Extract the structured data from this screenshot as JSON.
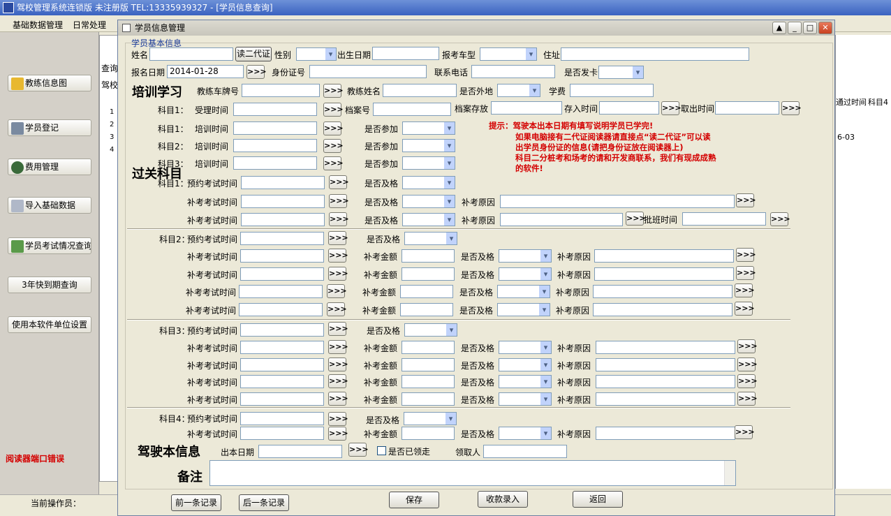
{
  "app": {
    "title": "驾校管理系统连锁版 未注册版 TEL:13335939327  - [学员信息查询]"
  },
  "menu": {
    "basic": "基础数据管理",
    "daily": "日常处理"
  },
  "sidebar": {
    "items": [
      "教练信息图",
      "学员登记",
      "费用管理",
      "导入基础数据",
      "学员考试情况查询",
      "3年快到期查询",
      "使用本软件单位设置"
    ],
    "error": "阅读器端口错误"
  },
  "status": {
    "operator_label": "当前操作员："
  },
  "bg": {
    "query1": "查询",
    "query2": "驾校",
    "rows": [
      "1",
      "2",
      "3",
      "4"
    ],
    "col1": "通过时间",
    "col2": "科目4",
    "cell": "6-03"
  },
  "window": {
    "title": "学员信息管理"
  },
  "basic": {
    "group": "学员基本信息",
    "name": "姓名",
    "read_id": "读二代证",
    "gender": "性别",
    "birth": "出生日期",
    "car_type": "报考车型",
    "address": "住址",
    "reg_date_label": "报名日期",
    "reg_date": "2014-01-28",
    "id_no": "身份证号",
    "phone": "联系电话",
    "card": "是否发卡"
  },
  "training": {
    "heading": "培训学习",
    "coach_plate": "教练车牌号",
    "coach_name": "教练姓名",
    "outside": "是否外地",
    "fee": "学费",
    "s1": "科目1：",
    "accept_time": "受理时间",
    "file_no": "档案号",
    "file_store": "档案存放",
    "store_time": "存入时间",
    "take_time": "取出时间",
    "train_time": "培训时间",
    "join": "是否参加",
    "s2": "科目2：",
    "s3": "科目3："
  },
  "tip": {
    "lines": [
      "提示：驾驶本出本日期有填写说明学员已学完!",
      "如果电脑接有二代证阅读器请直接点“读二代证”可以读",
      "出学员身份证的信息(请把身份证放在阅读器上)",
      "科目二分桩考和场考的请和开发商联系，我们有现成成熟",
      "的软件!"
    ]
  },
  "exam": {
    "heading": "过关科目",
    "s1": "科目1：",
    "s2": "科目2：",
    "s3": "科目3：",
    "s4": "科目4：",
    "appoint": "预约考试时间",
    "retake": "补考考试时间",
    "pass": "是否及格",
    "reason": "补考原因",
    "amount": "补考金额",
    "batch": "批班时间"
  },
  "license": {
    "heading": "驾驶本信息",
    "issue": "出本日期",
    "received": "是否已领走",
    "receiver": "领取人"
  },
  "memo": {
    "heading": "备注"
  },
  "buttons": {
    "prev": "前一条记录",
    "next": "后一条记录",
    "save": "保存",
    "fee_entry": "收款录入",
    "back": "返回",
    "arrow": ">>>"
  }
}
